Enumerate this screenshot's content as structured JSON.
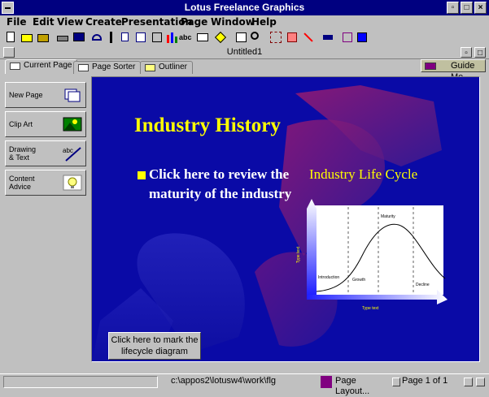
{
  "window": {
    "title": "Lotus Freelance Graphics"
  },
  "menu": [
    "File",
    "Edit",
    "View",
    "Create",
    "Presentation",
    "Page",
    "Window",
    "Help"
  ],
  "document": {
    "title": "Untitled1"
  },
  "tabs": [
    "Current Page",
    "Page Sorter",
    "Outliner"
  ],
  "guide_me": "Guide Me",
  "sidebar": [
    {
      "label": "New Page",
      "icon": "new-page-icon"
    },
    {
      "label": "Clip Art",
      "icon": "clip-art-icon"
    },
    {
      "label": "Drawing\n& Text",
      "icon": "drawing-text-icon"
    },
    {
      "label": "Content\nAdvice",
      "icon": "content-advice-icon"
    }
  ],
  "slide": {
    "title": "Industry History",
    "bullet": "Click here to review  the maturity of the industry",
    "chart_title": "Industry Life Cycle",
    "callout": "Click here to mark the lifecycle diagram"
  },
  "chart": {
    "phases": [
      "Introduction",
      "Growth",
      "Maturity",
      "Decline"
    ],
    "y_label": "Type text",
    "x_label": "Type text"
  },
  "status": {
    "path": "c:\\appos2\\lotusw4\\work\\flg",
    "layout": "Page Layout...",
    "page": "Page 1 of 1"
  },
  "colors": {
    "slide_bg": "#0a0aa6",
    "title": "#ffff00",
    "titlebar": "#000080"
  }
}
